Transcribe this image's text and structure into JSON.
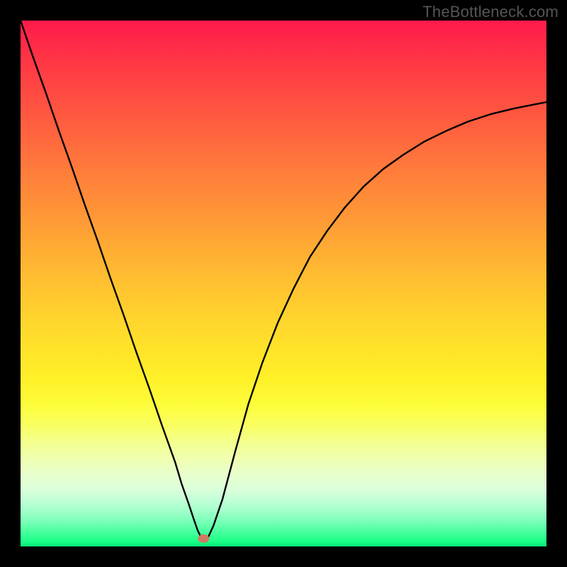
{
  "watermark": "TheBottleneck.com",
  "chart_data": {
    "type": "line",
    "title": "",
    "xlabel": "",
    "ylabel": "",
    "xlim": [
      0,
      100
    ],
    "ylim": [
      0,
      100
    ],
    "legend": false,
    "grid": false,
    "background_gradient": {
      "top_color": "#ff1a4b",
      "bottom_color": "#08e878",
      "orientation": "vertical"
    },
    "marker": {
      "x": 34.8,
      "y": 1.5,
      "color": "#d07b64"
    },
    "series": [
      {
        "name": "bottleneck-curve",
        "color": "#000000",
        "x": [
          0.0,
          2.4,
          4.9,
          7.3,
          9.8,
          12.2,
          14.7,
          17.1,
          19.6,
          22.0,
          24.5,
          26.9,
          29.4,
          30.6,
          32.0,
          33.0,
          33.7,
          34.3,
          34.8,
          35.7,
          36.7,
          38.4,
          40.8,
          43.3,
          46.0,
          48.9,
          51.9,
          55.0,
          58.3,
          61.7,
          65.3,
          69.0,
          72.8,
          76.8,
          80.9,
          85.1,
          89.4,
          93.9,
          98.5,
          100.0
        ],
        "y": [
          100.0,
          93.0,
          86.0,
          79.0,
          72.0,
          65.0,
          58.0,
          51.0,
          44.0,
          37.0,
          30.0,
          23.0,
          16.0,
          12.0,
          8.0,
          5.0,
          3.0,
          1.8,
          1.0,
          1.8,
          4.0,
          9.0,
          18.0,
          27.0,
          35.0,
          42.5,
          49.0,
          55.0,
          60.0,
          64.5,
          68.5,
          71.8,
          74.5,
          77.0,
          79.0,
          80.8,
          82.2,
          83.3,
          84.2,
          84.5
        ]
      }
    ]
  }
}
